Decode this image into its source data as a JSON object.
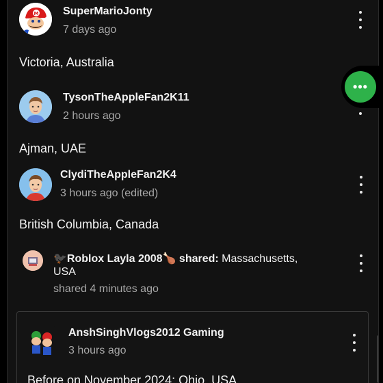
{
  "posts": [
    {
      "author": "SuperMarioJonty",
      "time": "7 days ago",
      "text": "Victoria, Australia",
      "avatar_icon": "mario-avatar-icon"
    },
    {
      "author": "TysonTheAppleFan2K11",
      "time": "2 hours ago",
      "text": "Ajman, UAE",
      "avatar_icon": "memoji-boy-avatar-icon"
    },
    {
      "author": "ClydiTheAppleFan2K4",
      "time": "3 hours ago (edited)",
      "text": "British Columbia, Canada",
      "avatar_icon": "memoji-boy-red-avatar-icon"
    }
  ],
  "share": {
    "line1_prefix": "🐦‍⬛",
    "line1_name": "Roblox Layla 2008",
    "line1_suffix": "🍗",
    "line1_action": " shared:",
    "line1_value": " Massachusetts,",
    "line2": "USA",
    "time": "shared 4 minutes ago"
  },
  "shared_post": {
    "author": "AnshSinghVlogs2012 Gaming",
    "time": "3 hours ago",
    "text": "Before on November 2024: Ohio, USA"
  },
  "fab": {
    "label": "•••",
    "color": "#2eb24a"
  },
  "colors": {
    "background": "#121212",
    "text": "#f2f2f2",
    "muted": "#a8a8a8"
  }
}
